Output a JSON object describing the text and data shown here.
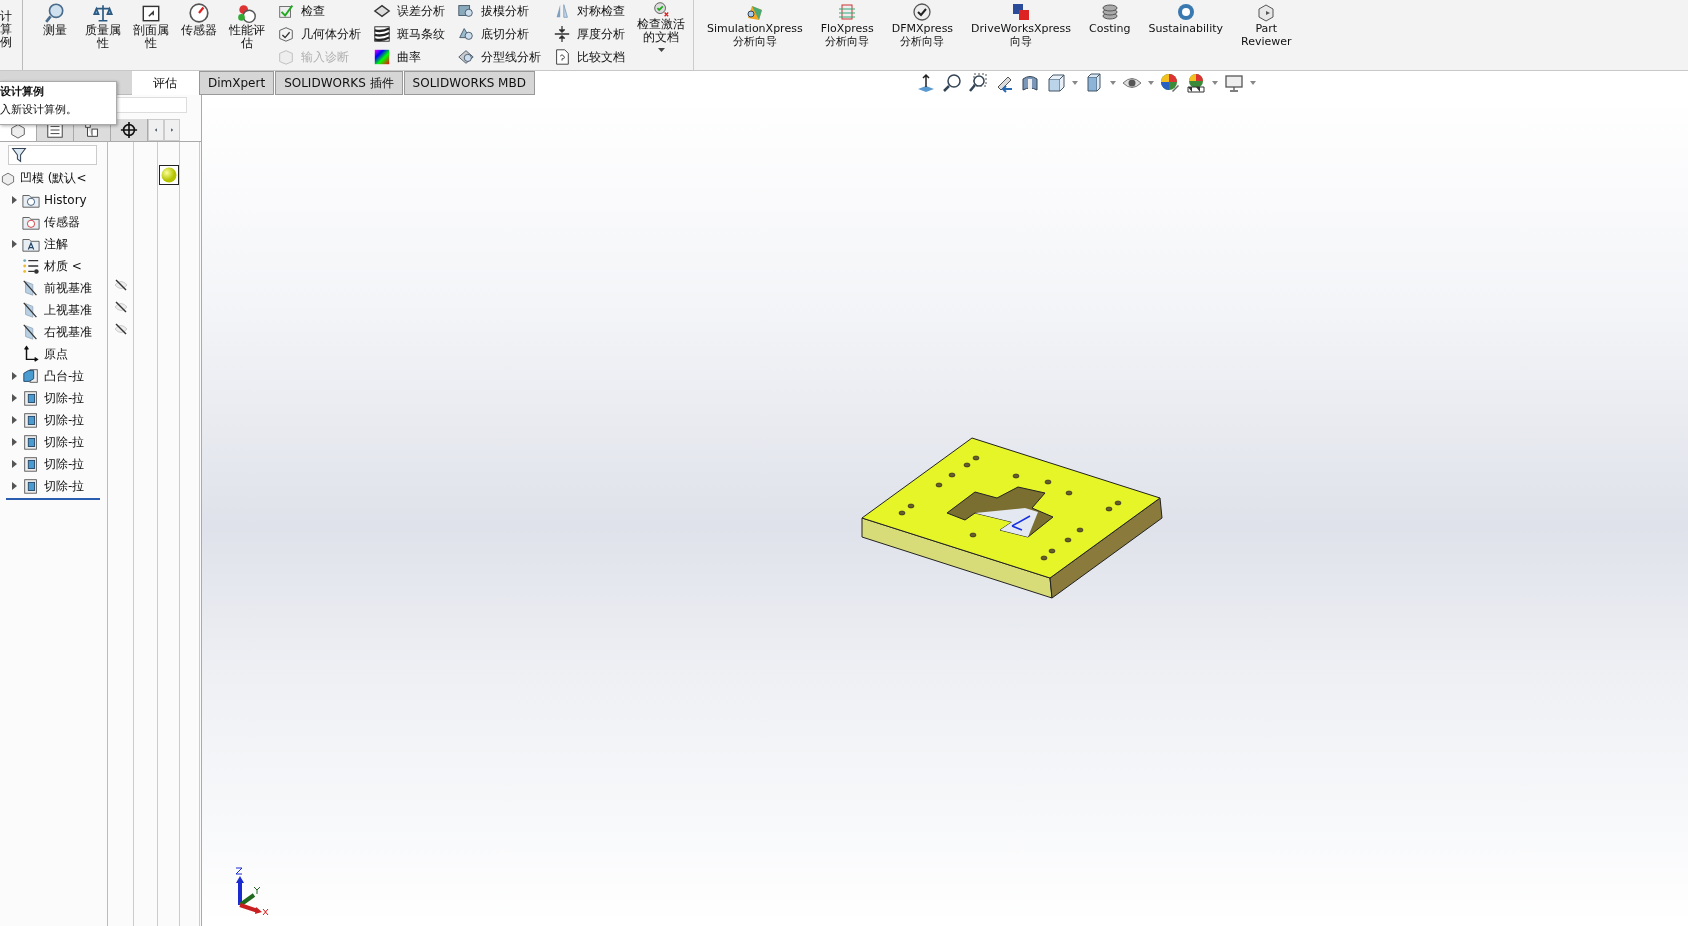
{
  "ribbon": {
    "partial_button": {
      "lines": [
        "计算",
        "例"
      ]
    },
    "large_tools": [
      {
        "label": "测量",
        "kind": "measure"
      },
      {
        "label": "质量属性",
        "kind": "mass"
      },
      {
        "label": "剖面属性",
        "kind": "section"
      },
      {
        "label": "传感器",
        "kind": "sensor"
      },
      {
        "label": "性能评估",
        "kind": "performance"
      }
    ],
    "small_tool_columns": [
      [
        {
          "label": "检查",
          "kind": "check",
          "disabled": false
        },
        {
          "label": "几何体分析",
          "kind": "geometry",
          "disabled": false
        },
        {
          "label": "输入诊断",
          "kind": "import",
          "disabled": true
        }
      ],
      [
        {
          "label": "误差分析",
          "kind": "deviation",
          "disabled": false
        },
        {
          "label": "斑马条纹",
          "kind": "zebra",
          "disabled": false
        },
        {
          "label": "曲率",
          "kind": "curvature",
          "disabled": false
        }
      ],
      [
        {
          "label": "拔模分析",
          "kind": "draft",
          "disabled": false
        },
        {
          "label": "底切分析",
          "kind": "undercut",
          "disabled": false
        },
        {
          "label": "分型线分析",
          "kind": "parting",
          "disabled": false
        }
      ],
      [
        {
          "label": "对称检查",
          "kind": "symmetry",
          "disabled": false
        },
        {
          "label": "厚度分析",
          "kind": "thickness",
          "disabled": false
        },
        {
          "label": "比较文档",
          "kind": "compare",
          "disabled": false
        }
      ]
    ],
    "check_active": {
      "label": "检查激活的文档"
    },
    "addins": [
      {
        "lines": [
          "SimulationXpress",
          "分析向导"
        ],
        "kind": "simulation"
      },
      {
        "lines": [
          "FloXpress",
          "分析向导"
        ],
        "kind": "flow"
      },
      {
        "lines": [
          "DFMXpress",
          "分析向导"
        ],
        "kind": "dfm"
      },
      {
        "lines": [
          "DriveWorksXpress",
          "向导"
        ],
        "kind": "driveworks"
      },
      {
        "lines": [
          "Costing"
        ],
        "kind": "costing"
      },
      {
        "lines": [
          "Sustainability"
        ],
        "kind": "sustainability"
      },
      {
        "lines": [
          "Part",
          "Reviewer"
        ],
        "kind": "reviewer"
      }
    ]
  },
  "tabs": [
    {
      "label": "评估",
      "selected": true
    },
    {
      "label": "DimXpert",
      "selected": false
    },
    {
      "label": "SOLIDWORKS 插件",
      "selected": false
    },
    {
      "label": "SOLIDWORKS MBD",
      "selected": false
    }
  ],
  "tooltip": {
    "title": "设计算例",
    "text": "入新设计算例。"
  },
  "feature_tree": {
    "root": "凹模 (默认<",
    "items": [
      {
        "label": "History",
        "kind": "history",
        "expandable": true,
        "eye": false
      },
      {
        "label": "传感器",
        "kind": "sensors",
        "expandable": false,
        "eye": false
      },
      {
        "label": "注解",
        "kind": "annotations",
        "expandable": true,
        "eye": false
      },
      {
        "label": "材质 <",
        "kind": "material",
        "expandable": false,
        "eye": false
      },
      {
        "label": "前视基准",
        "kind": "plane",
        "expandable": false,
        "eye": true
      },
      {
        "label": "上视基准",
        "kind": "plane",
        "expandable": false,
        "eye": true
      },
      {
        "label": "右视基准",
        "kind": "plane",
        "expandable": false,
        "eye": true
      },
      {
        "label": "原点",
        "kind": "origin",
        "expandable": false,
        "eye": false
      },
      {
        "label": "凸台-拉",
        "kind": "boss",
        "expandable": true,
        "eye": false
      },
      {
        "label": "切除-拉",
        "kind": "cut",
        "expandable": true,
        "eye": false
      },
      {
        "label": "切除-拉",
        "kind": "cut",
        "expandable": true,
        "eye": false
      },
      {
        "label": "切除-拉",
        "kind": "cut",
        "expandable": true,
        "eye": false
      },
      {
        "label": "切除-拉",
        "kind": "cut",
        "expandable": true,
        "eye": false
      },
      {
        "label": "切除-拉",
        "kind": "cut",
        "expandable": true,
        "eye": false
      }
    ]
  }
}
